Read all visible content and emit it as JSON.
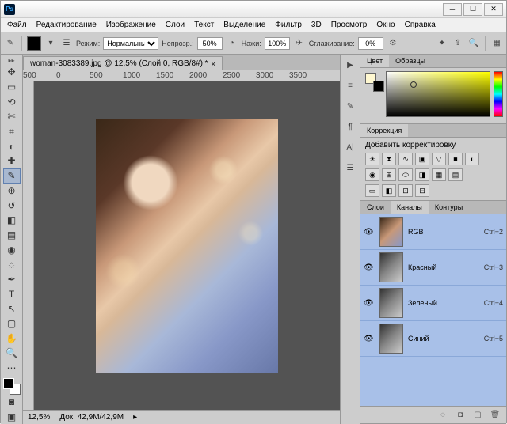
{
  "menu": [
    "Файл",
    "Редактирование",
    "Изображение",
    "Слои",
    "Текст",
    "Выделение",
    "Фильтр",
    "3D",
    "Просмотр",
    "Окно",
    "Справка"
  ],
  "opt": {
    "mode_lbl": "Режим:",
    "mode_val": "Нормальный",
    "opac_lbl": "Непрозр.:",
    "opac_val": "50%",
    "flow_lbl": "Нажи:",
    "flow_val": "100%",
    "smooth_lbl": "Сглаживание:",
    "smooth_val": "0%"
  },
  "tab": {
    "title": "woman-3083389.jpg @ 12,5% (Слой 0, RGB/8#) *"
  },
  "ruler_marks": [
    "500",
    "0",
    "500",
    "1000",
    "1500",
    "2000",
    "2500",
    "3000",
    "3500"
  ],
  "status": {
    "zoom": "12,5%",
    "doc": "Док: 42,9M/42,9M"
  },
  "panels": {
    "color_tabs": [
      "Цвет",
      "Образцы"
    ],
    "adj_tab": "Коррекция",
    "adj_label": "Добавить корректировку",
    "layers_tabs": [
      "Слои",
      "Каналы",
      "Контуры"
    ]
  },
  "channels": [
    {
      "name": "RGB",
      "shortcut": "Ctrl+2",
      "rgb": true
    },
    {
      "name": "Красный",
      "shortcut": "Ctrl+3",
      "rgb": false
    },
    {
      "name": "Зеленый",
      "shortcut": "Ctrl+4",
      "rgb": false
    },
    {
      "name": "Синий",
      "shortcut": "Ctrl+5",
      "rgb": false
    }
  ]
}
